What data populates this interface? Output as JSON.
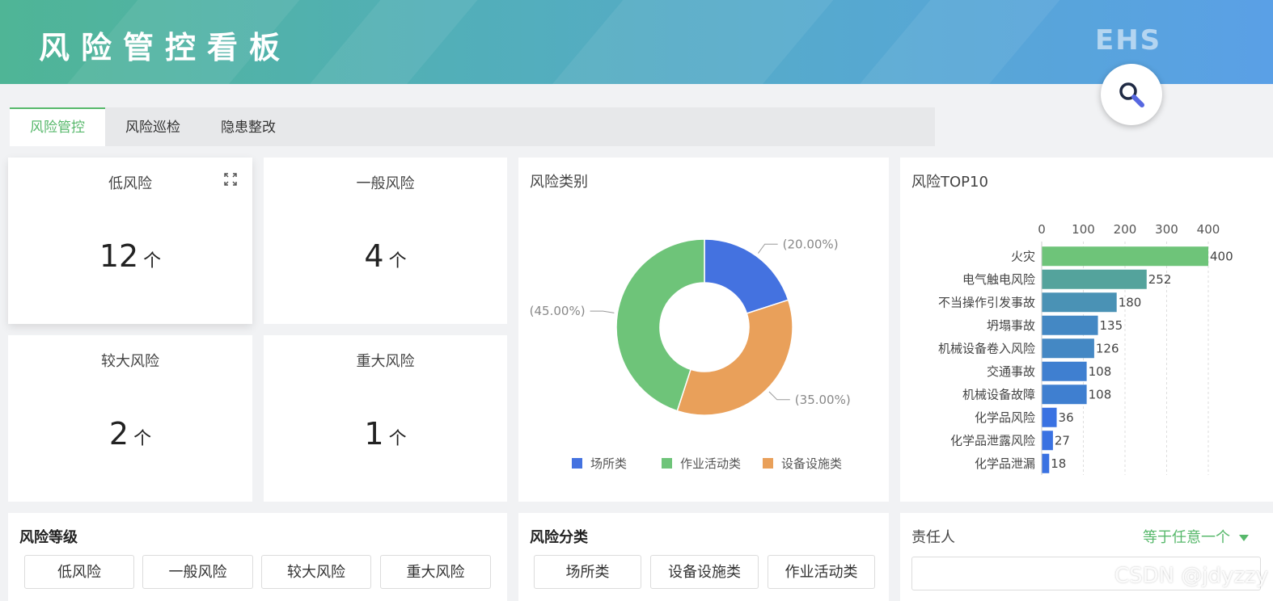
{
  "header": {
    "title": "风险管控看板",
    "logo_text": "EHS"
  },
  "tabs": [
    {
      "label": "风险管控",
      "active": true
    },
    {
      "label": "风险巡检",
      "active": false
    },
    {
      "label": "隐患整改",
      "active": false
    }
  ],
  "risk_cards": [
    {
      "label": "低风险",
      "value": "12",
      "unit": "个"
    },
    {
      "label": "一般风险",
      "value": "4",
      "unit": "个"
    },
    {
      "label": "较大风险",
      "value": "2",
      "unit": "个"
    },
    {
      "label": "重大风险",
      "value": "1",
      "unit": "个"
    }
  ],
  "category_chart": {
    "title": "风险类别"
  },
  "top10_chart": {
    "title": "风险TOP10"
  },
  "chart_data": [
    {
      "type": "pie",
      "title": "风险类别",
      "donut": true,
      "slices": [
        {
          "name": "场所类",
          "value": 20.0,
          "label": "(20.00%)",
          "color": "#4472e0"
        },
        {
          "name": "设备设施类",
          "value": 35.0,
          "label": "(35.00%)",
          "color": "#e9a05a"
        },
        {
          "name": "作业活动类",
          "value": 45.0,
          "label": "(45.00%)",
          "color": "#6ec479"
        }
      ],
      "legend": [
        {
          "name": "场所类",
          "color": "#4472e0"
        },
        {
          "name": "作业活动类",
          "color": "#6ec479"
        },
        {
          "name": "设备设施类",
          "color": "#e9a05a"
        }
      ],
      "legend_placement": "bottom"
    },
    {
      "type": "bar",
      "orientation": "horizontal",
      "title": "风险TOP10",
      "categories": [
        "火灾",
        "电气触电风险",
        "不当操作引发事故",
        "坍塌事故",
        "机械设备卷入风险",
        "交通事故",
        "机械设备故障",
        "化学品风险",
        "化学品泄露风险",
        "化学品泄漏"
      ],
      "values": [
        400,
        252,
        180,
        135,
        126,
        108,
        108,
        36,
        27,
        18
      ],
      "xlim": [
        0,
        400
      ],
      "x_ticks": [
        "0",
        "100",
        "200",
        "300",
        "400"
      ],
      "x_axis_position": "top",
      "grid": true,
      "colors": [
        "#6ec479",
        "#54a39c",
        "#4a92b5",
        "#4488c4",
        "#4488c4",
        "#3f7fd0",
        "#3f7fd0",
        "#3a72e2",
        "#3a72e2",
        "#3a72e2"
      ]
    }
  ],
  "filters": {
    "level": {
      "title": "风险等级",
      "options": [
        "低风险",
        "一般风险",
        "较大风险",
        "重大风险"
      ]
    },
    "classify": {
      "title": "风险分类",
      "options": [
        "场所类",
        "设备设施类",
        "作业活动类"
      ]
    },
    "owner": {
      "title": "责任人",
      "mode": "等于任意一个",
      "value": ""
    }
  },
  "watermark": "CSDN @jdyzzy"
}
